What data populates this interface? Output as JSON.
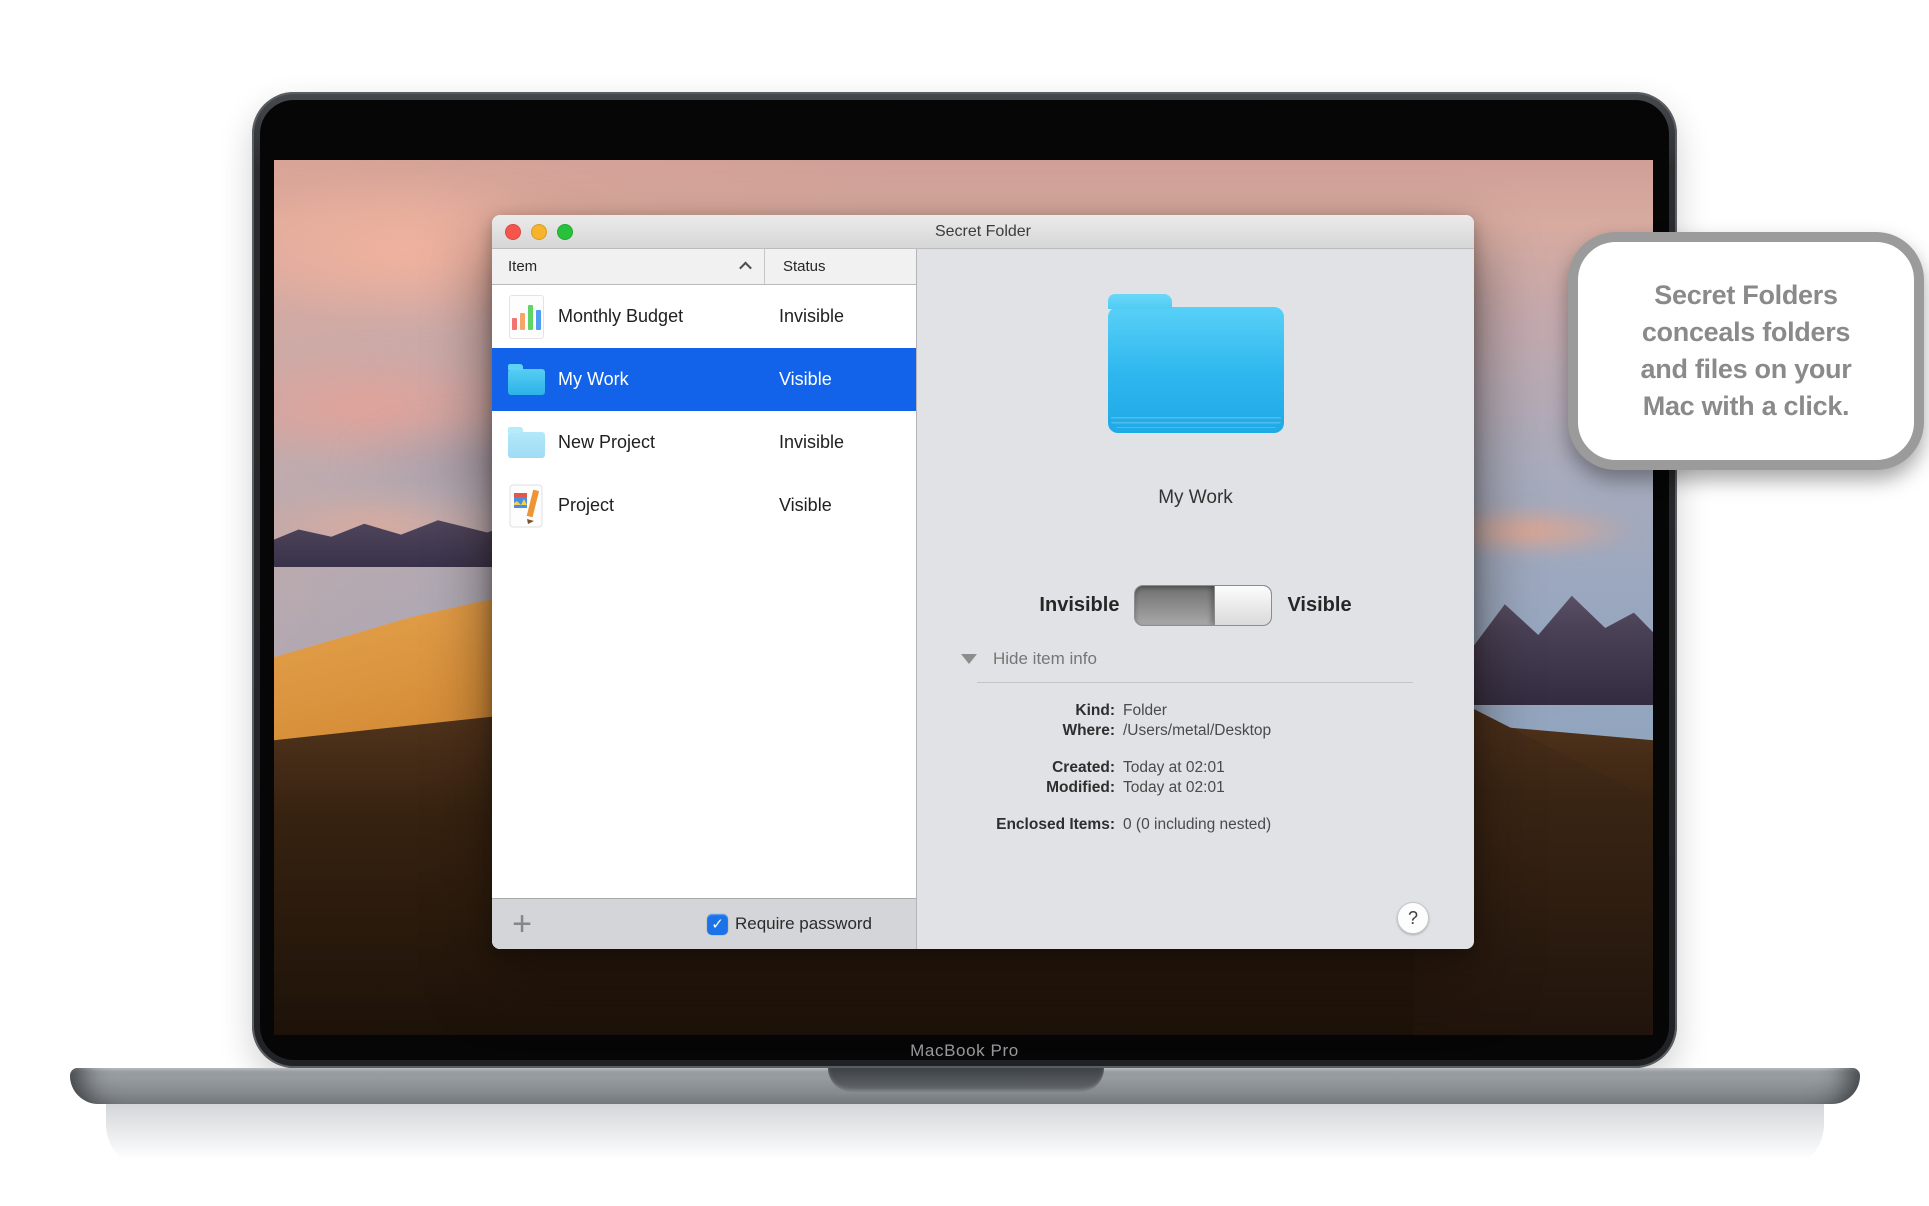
{
  "laptop": {
    "label": "MacBook Pro"
  },
  "callout": {
    "lines": [
      "Secret Folders",
      "conceals folders",
      "and files on your",
      "Mac with a click."
    ]
  },
  "window": {
    "title": "Secret Folder",
    "list": {
      "columns": [
        "Item",
        "Status"
      ],
      "sort_column": "Item",
      "sort_direction": "ascending",
      "rows": [
        {
          "name": "Monthly Budget",
          "status": "Invisible",
          "icon": "chart-icon",
          "selected": false
        },
        {
          "name": "My Work",
          "status": "Visible",
          "icon": "folder-icon",
          "selected": true
        },
        {
          "name": "New Project",
          "status": "Invisible",
          "icon": "folder-faded-icon",
          "selected": false
        },
        {
          "name": "Project",
          "status": "Visible",
          "icon": "document-icon",
          "selected": false
        }
      ]
    },
    "bottom_bar": {
      "add_label": "+",
      "checkbox_label": "Require password",
      "checkbox_checked": true,
      "check_glyph": "✓"
    },
    "detail": {
      "item_name": "My Work",
      "toggle": {
        "left_label": "Invisible",
        "right_label": "Visible",
        "state": "visible"
      },
      "disclosure_label": "Hide item info",
      "info": [
        {
          "label": "Kind:",
          "value": "Folder"
        },
        {
          "label": "Where:",
          "value": "/Users/metal/Desktop"
        },
        {
          "label": "Created:",
          "value": "Today at 02:01"
        },
        {
          "label": "Modified:",
          "value": "Today at 02:01"
        },
        {
          "label": "Enclosed Items:",
          "value": "0 (0 including nested)"
        }
      ],
      "help_label": "?"
    }
  },
  "colors": {
    "selection_blue": "#1263e9",
    "checkbox_blue": "#1a73e8",
    "folder_blue_top": "#58d0f7",
    "folder_blue_bottom": "#1fa9e6",
    "bubble_text_gray": "#8a8a8a"
  }
}
